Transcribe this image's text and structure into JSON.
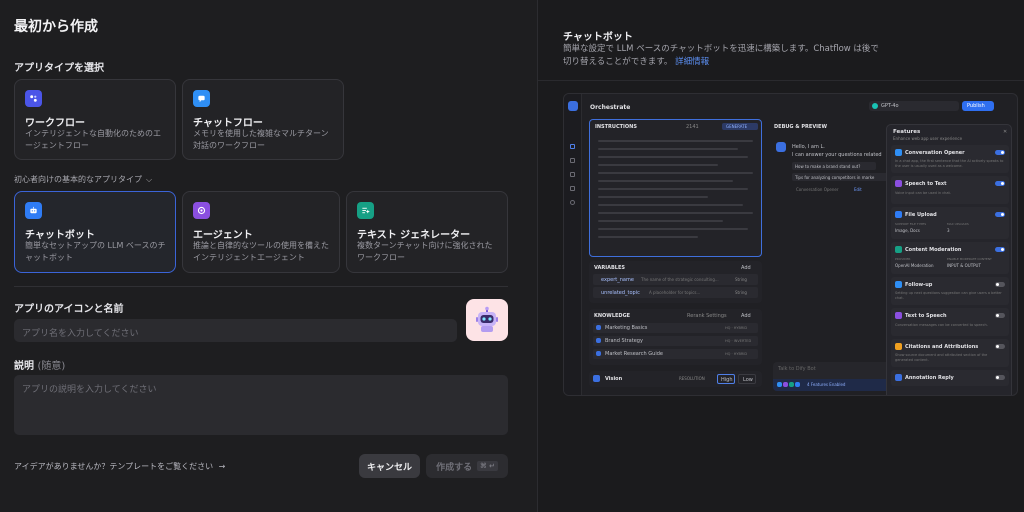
{
  "left": {
    "title": "最初から作成",
    "app_type_label": "アプリタイプを選択",
    "top_cards": [
      {
        "title": "ワークフロー",
        "desc": "インテリジェントな自動化のためのエージェントフロー",
        "icon": "workflow-icon",
        "color": "#4b55e8"
      },
      {
        "title": "チャットフロー",
        "desc": "メモリを使用した複雑なマルチターン対話のワークフロー",
        "icon": "chatflow-icon",
        "color": "#2f8ff5"
      }
    ],
    "beginner_label": "初心者向けの基本的なアプリタイプ",
    "basic_cards": [
      {
        "title": "チャットボット",
        "desc": "簡単なセットアップの LLM ベースのチャットボット",
        "icon": "chatbot-icon",
        "color": "#2f7cf5"
      },
      {
        "title": "エージェント",
        "desc": "推論と自律的なツールの使用を備えたインテリジェントエージェント",
        "icon": "agent-icon",
        "color": "#8b4fe0"
      },
      {
        "title": "テキスト ジェネレーター",
        "desc": "複数ターンチャット向けに強化されたワークフロー",
        "icon": "text-generator-icon",
        "color": "#16a085"
      }
    ],
    "icon_name_label": "アプリのアイコンと名前",
    "name_placeholder": "アプリ名を入力してください",
    "desc_label": "説明",
    "desc_optional": "(随意)",
    "desc_placeholder": "アプリの説明を入力してください",
    "template_link": "アイデアがありませんか？テンプレートをご覧ください",
    "template_arrow": "→",
    "cancel": "キャンセル",
    "create": "作成する",
    "create_shortcut": "⌘ ↵"
  },
  "right": {
    "title": "チャットボット",
    "desc_line1": "簡単な設定で LLM ベースのチャットボットを迅速に構築します。Chatflow は後で",
    "desc_line2": "切り替えることができます。",
    "learn_more": "詳細情報",
    "preview": {
      "app_title": "Orchestrate",
      "model": "GPT-4o",
      "publish": "Publish",
      "instructions": "INSTRUCTIONS",
      "char_count": "2141",
      "generate": "GENERATE",
      "debug": "DEBUG & PREVIEW",
      "greeting1": "Hello, I am L.",
      "greeting2": "I can answer your questions related",
      "suggestions": [
        "How to make a brand stand out?",
        "Tips for analyzing competitors in marke"
      ],
      "opener_note": "Conversation Opener",
      "edit": "Edit",
      "variables": "VARIABLES",
      "add": "Add",
      "var_rows": [
        {
          "key": "expert_name",
          "desc": "The name of the strategic consulting...",
          "type": "String"
        },
        {
          "key": "unrelated_topic",
          "desc": "A placeholder for topics...",
          "type": "String"
        }
      ],
      "knowledge": "KNOWLEDGE",
      "rerank": "Rerank Settings",
      "knowledge_rows": [
        "Marketing Basics",
        "Brand Strategy",
        "Market Research Guide"
      ],
      "knowledge_tags": [
        "HQ · HYBRID",
        "HQ · INVERTED",
        "HQ · HYBRID"
      ],
      "vision": "Vision",
      "resolution": "RESOLUTION",
      "high": "High",
      "low": "Low",
      "talk": "Talk to Dify Bot",
      "features_enabled": "4 Features Enabled",
      "features_title": "Features",
      "features_sub": "Enhance web app user experience",
      "features": [
        {
          "name": "Conversation Opener",
          "desc": "In a chat app, the first sentence that the AI actively speaks to the user is usually used as a welcome.",
          "on": true,
          "color": "#2f8ff5"
        },
        {
          "name": "Speech to Text",
          "desc": "Voice input can be used in chat.",
          "on": true,
          "color": "#8b4fe0"
        },
        {
          "name": "File Upload",
          "desc": "",
          "on": true,
          "color": "#2f7cf5",
          "meta1": "SUPPORT FILE TYPES",
          "meta1v": "Image, Docs",
          "meta2": "MAX UPLOADS",
          "meta2v": "3"
        },
        {
          "name": "Content Moderation",
          "desc": "",
          "on": true,
          "color": "#16a085",
          "meta1": "PROVIDER",
          "meta1v": "OpenAI Moderation",
          "meta2": "ENABLE MODERATE CONTENT",
          "meta2v": "INPUT & OUTPUT"
        },
        {
          "name": "Follow-up",
          "desc": "Setting up next questions suggestion can give users a better chat.",
          "on": false,
          "color": "#2f8ff5"
        },
        {
          "name": "Text to Speech",
          "desc": "Conversation messages can be converted to speech.",
          "on": false,
          "color": "#8b4fe0"
        },
        {
          "name": "Citations and Attributions",
          "desc": "Show source document and attributed section of the generated content.",
          "on": false,
          "color": "#f0a020"
        },
        {
          "name": "Annotation Reply",
          "desc": "",
          "on": false,
          "color": "#3b6fe0"
        }
      ]
    }
  }
}
